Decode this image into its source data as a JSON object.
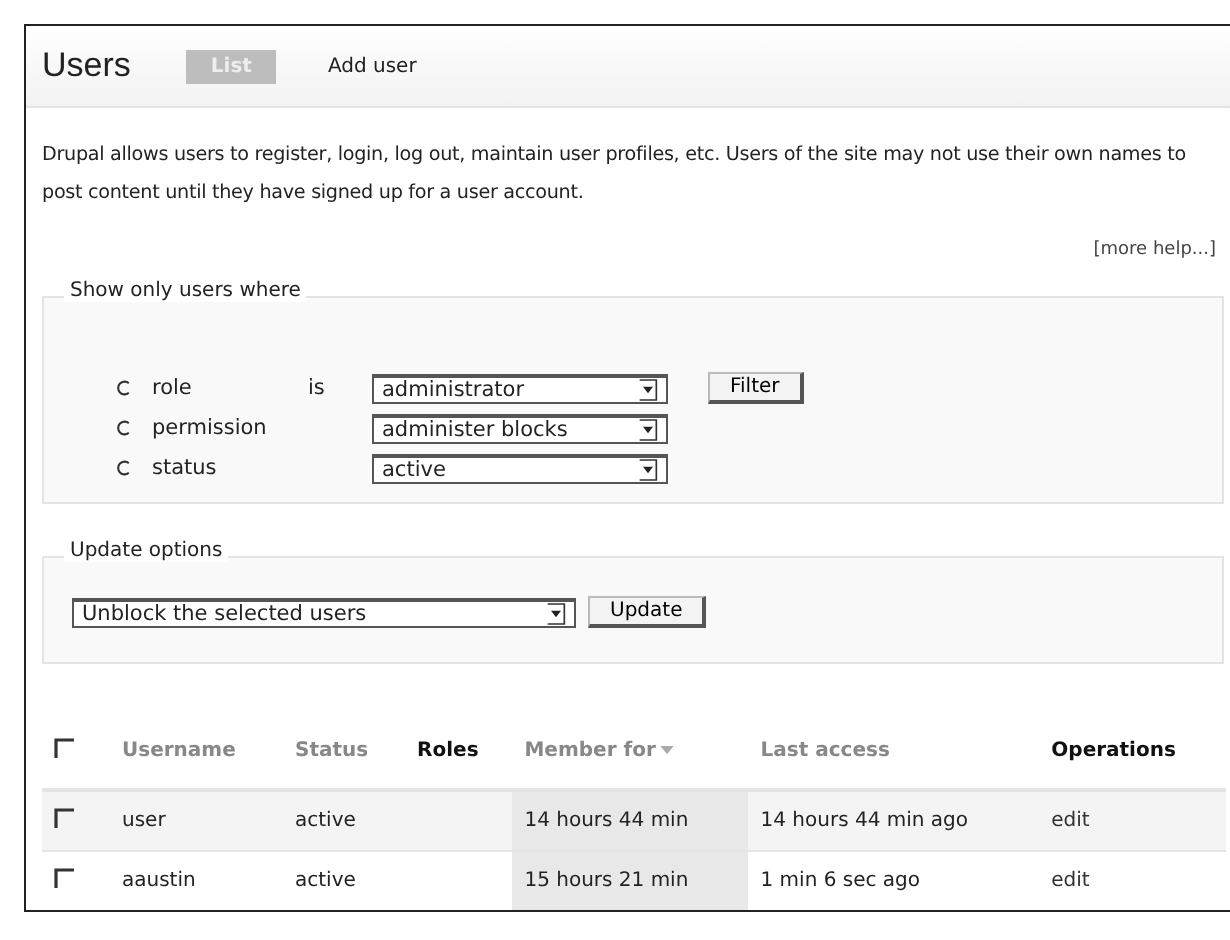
{
  "title": "Users",
  "tabs": [
    {
      "label": "List",
      "selected": true
    },
    {
      "label": "Add user",
      "selected": false
    }
  ],
  "description": "Drupal allows users to register, login, log out, maintain user profiles, etc. Users of the site may not use their own names to post content until they have signed up for a user account.",
  "more_help": "[more help...]",
  "filter": {
    "legend": "Show only users where",
    "operator": "is",
    "criteria": [
      {
        "label": "role",
        "selected": false,
        "value": "administrator"
      },
      {
        "label": "permission",
        "selected": false,
        "value": "administer blocks"
      },
      {
        "label": "status",
        "selected": false,
        "value": "active"
      }
    ],
    "button": "Filter"
  },
  "update": {
    "legend": "Update options",
    "value": "Unblock the selected users",
    "button": "Update"
  },
  "table": {
    "select_all": {
      "checked": false
    },
    "columns": [
      {
        "label": "Username",
        "sortable": true,
        "sorted": false
      },
      {
        "label": "Status",
        "sortable": true,
        "sorted": false
      },
      {
        "label": "Roles",
        "sortable": false,
        "sorted": false
      },
      {
        "label": "Member for",
        "sortable": true,
        "sorted": true
      },
      {
        "label": "Last access",
        "sortable": true,
        "sorted": false
      },
      {
        "label": "Operations",
        "sortable": false,
        "sorted": false
      }
    ],
    "rows": [
      {
        "checked": false,
        "cells": [
          "user",
          "active",
          "",
          "14 hours 44 min",
          "14 hours 44 min ago",
          "edit"
        ]
      },
      {
        "checked": false,
        "cells": [
          "aaustin",
          "active",
          "",
          "15 hours 21 min",
          "1 min 6 sec ago",
          "edit"
        ]
      }
    ]
  }
}
